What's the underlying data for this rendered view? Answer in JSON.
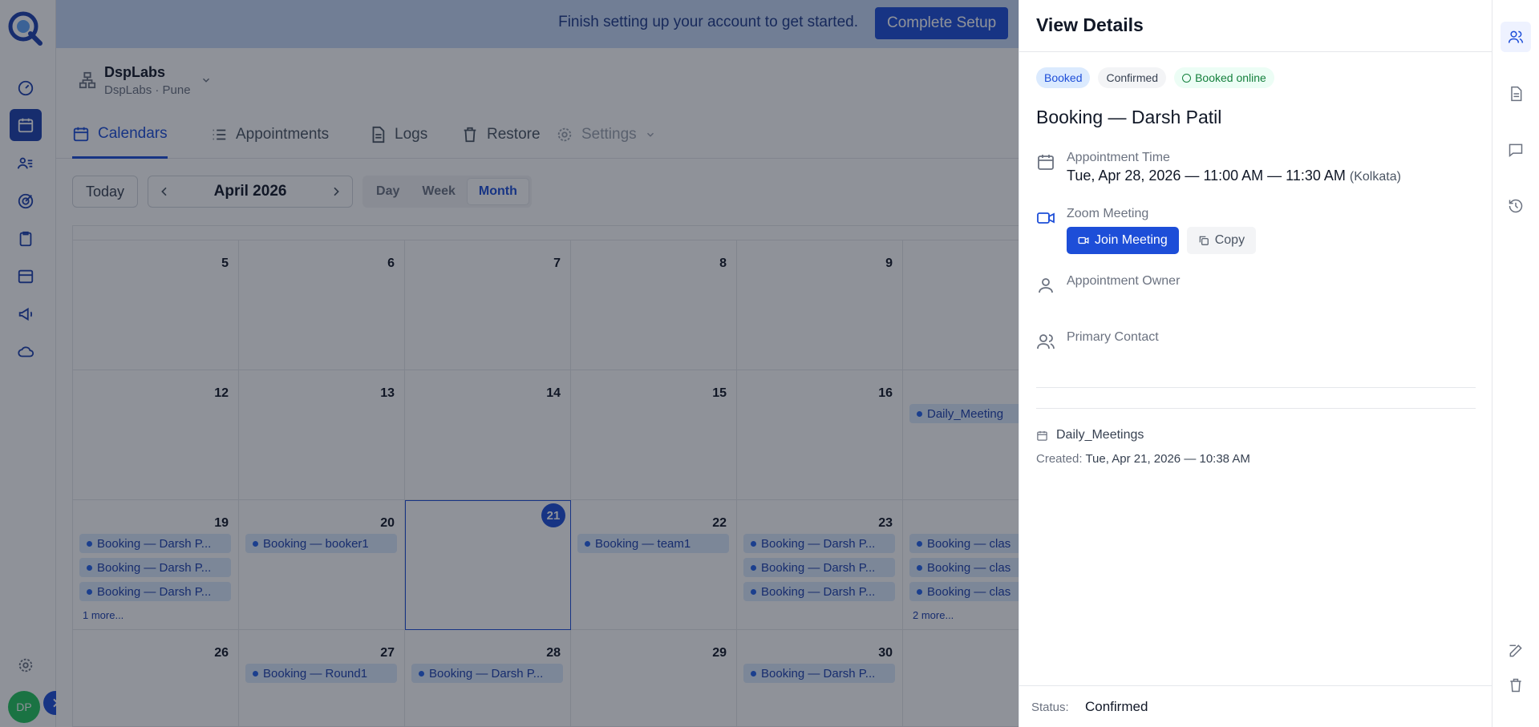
{
  "banner": {
    "message": "Finish setting up your account to get started.",
    "cta": "Complete Setup"
  },
  "org": {
    "name": "DspLabs",
    "location": "DspLabs · Pune"
  },
  "tabs": {
    "calendars": "Calendars",
    "appointments": "Appointments",
    "logs": "Logs",
    "restore": "Restore",
    "settings": "Settings"
  },
  "toolbar": {
    "today": "Today",
    "month": "April 2026",
    "views": {
      "day": "Day",
      "week": "Week",
      "month": "Month"
    }
  },
  "calendar": {
    "days": {
      "d5": "5",
      "d6": "6",
      "d7": "7",
      "d8": "8",
      "d9": "9",
      "d12": "12",
      "d13": "13",
      "d14": "14",
      "d15": "15",
      "d16": "16",
      "d19": "19",
      "d20": "20",
      "d21": "21",
      "d22": "22",
      "d23": "23",
      "d26": "26",
      "d27": "27",
      "d28": "28",
      "d29": "29",
      "d30": "30"
    },
    "events": {
      "d17_1": "Daily_Meeting",
      "d19_1": "Booking — Darsh P...",
      "d19_2": "Booking — Darsh P...",
      "d19_3": "Booking — Darsh P...",
      "d19_more": "1 more...",
      "d20_1": "Booking — booker1",
      "d22_1": "Booking — team1",
      "d23_1": "Booking — Darsh P...",
      "d23_2": "Booking — Darsh P...",
      "d23_3": "Booking — Darsh P...",
      "d24_1": "Booking — clas",
      "d24_2": "Booking — clas",
      "d24_3": "Booking — clas",
      "d24_more": "2 more...",
      "d27_1": "Booking — Round1",
      "d28_1": "Booking — Darsh P...",
      "d30_1": "Booking — Darsh P..."
    }
  },
  "details": {
    "title": "View Details",
    "chips": {
      "booked": "Booked",
      "confirmed": "Confirmed",
      "online": "Booked online"
    },
    "booking_title": "Booking — Darsh Patil",
    "time_label": "Appointment Time",
    "time_value": "Tue, Apr 28, 2026 — 11:00 AM — 11:30 AM",
    "timezone": "(Kolkata)",
    "zoom_label": "Zoom Meeting",
    "join": "Join Meeting",
    "copy": "Copy",
    "owner_label": "Appointment Owner",
    "contact_label": "Primary Contact",
    "calendar_name": "Daily_Meetings",
    "created_label": "Created:",
    "created_value": "Tue, Apr 21, 2026 — 10:38 AM",
    "status_label": "Status:",
    "status_value": "Confirmed"
  },
  "user": {
    "initials": "DP"
  },
  "colors": {
    "brand": "#1d4ed8",
    "chip_booked": "#dbeafe",
    "chip_online": "#15803d"
  }
}
